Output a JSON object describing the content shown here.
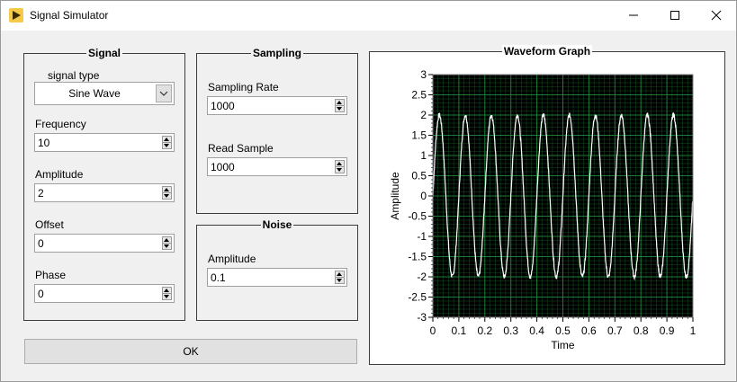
{
  "window": {
    "title": "Signal Simulator",
    "accent_color": "#f7c948"
  },
  "signal": {
    "group_title": "Signal",
    "type_label": "signal type",
    "type_value": "Sine Wave",
    "frequency_label": "Frequency",
    "frequency_value": "10",
    "amplitude_label": "Amplitude",
    "amplitude_value": "2",
    "offset_label": "Offset",
    "offset_value": "0",
    "phase_label": "Phase",
    "phase_value": "0"
  },
  "sampling": {
    "group_title": "Sampling",
    "rate_label": "Sampling Rate",
    "rate_value": "1000",
    "read_label": "Read Sample",
    "read_value": "1000"
  },
  "noise": {
    "group_title": "Noise",
    "amplitude_label": "Amplitude",
    "amplitude_value": "0.1"
  },
  "ok_label": "OK",
  "graph": {
    "title": "Waveform Graph",
    "plot_bg": "#000000",
    "grid_color": "#1f8a3a",
    "trace_color": "#ffffff"
  },
  "chart_data": {
    "type": "line",
    "title": "Waveform Graph",
    "xlabel": "Time",
    "ylabel": "Amplitude",
    "xlim": [
      0,
      1
    ],
    "ylim": [
      -3,
      3
    ],
    "x_ticks": [
      "0",
      "0.1",
      "0.2",
      "0.3",
      "0.4",
      "0.5",
      "0.6",
      "0.7",
      "0.8",
      "0.9",
      "1"
    ],
    "y_ticks": [
      "3",
      "2.5",
      "2",
      "1.5",
      "1",
      "0.5",
      "0",
      "-0.5",
      "-1",
      "-1.5",
      "-2",
      "-2.5",
      "-3"
    ],
    "grid": true,
    "series": [
      {
        "signal": "sine",
        "frequency": 10,
        "amplitude": 2,
        "offset": 0,
        "phase": 0,
        "noise_amplitude": 0.1,
        "samples": 1000
      }
    ]
  }
}
